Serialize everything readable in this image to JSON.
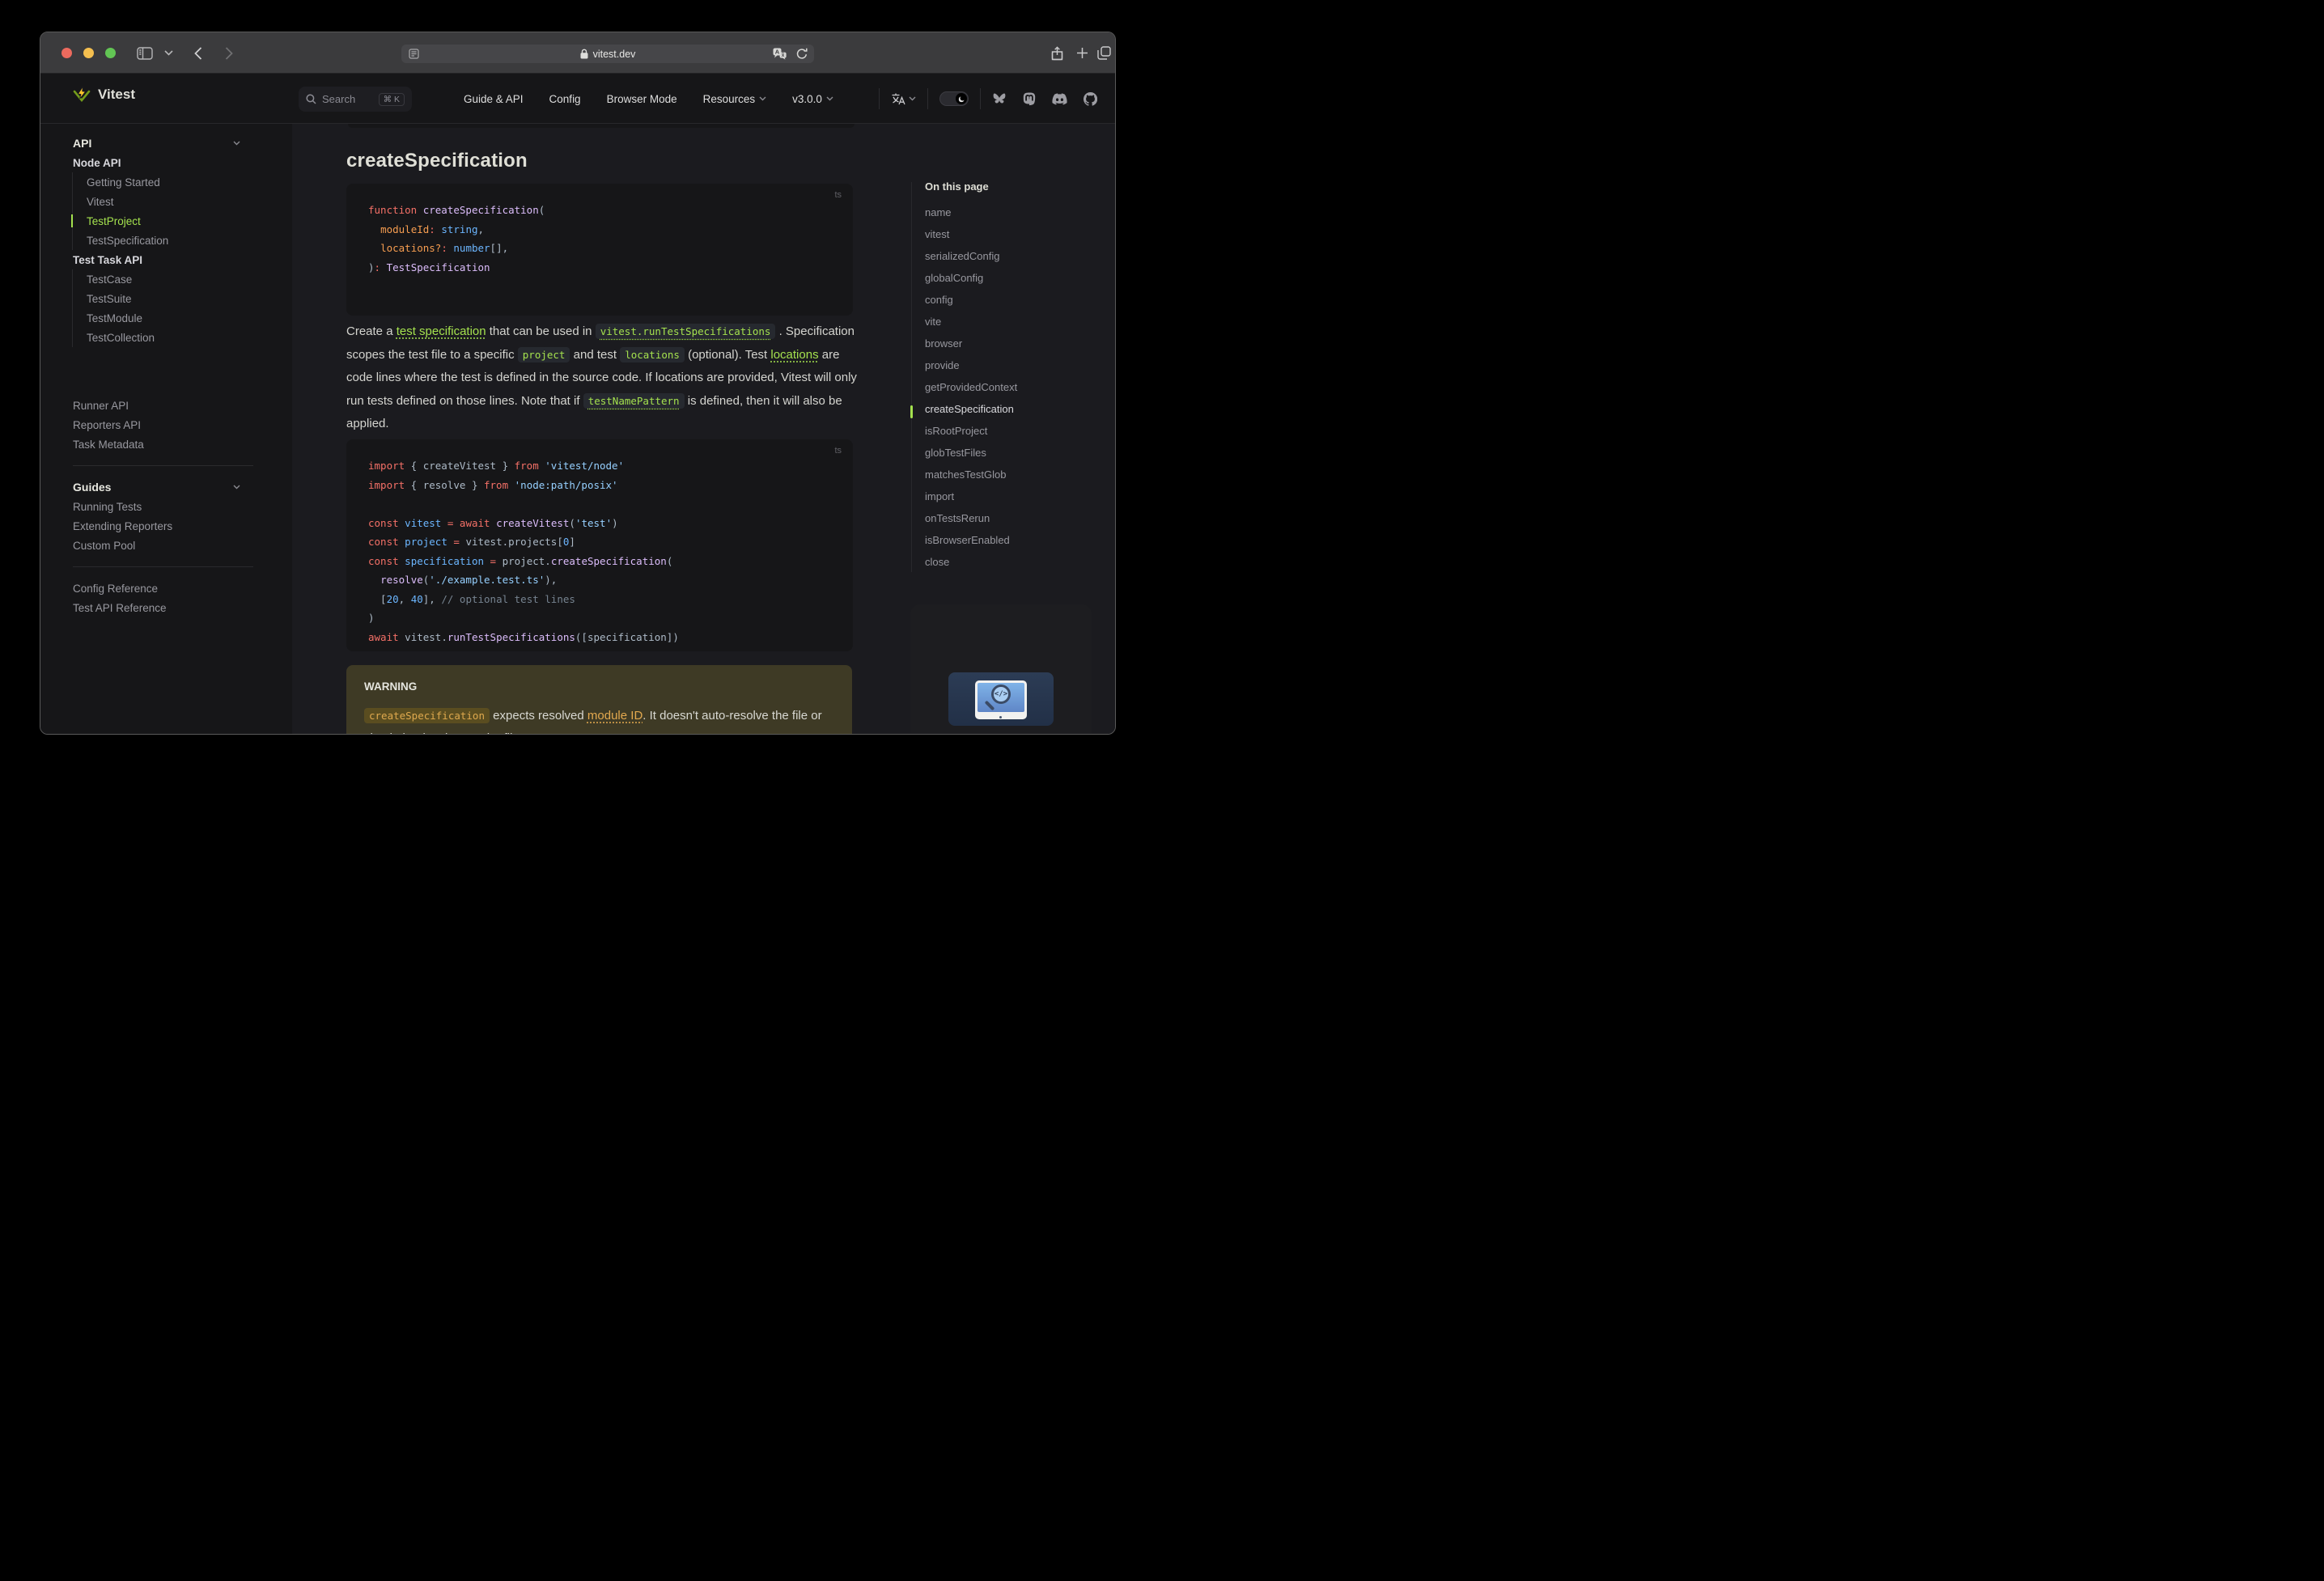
{
  "colors": {
    "accent_green": "#a4e14e",
    "content_bg": "#1b1b1f",
    "panel_bg": "#161618",
    "chrome_bg": "#3b3b3d",
    "warning_bg": "#3e3a25",
    "warning_orange": "#dfa94e"
  },
  "browser": {
    "url": "vitest.dev"
  },
  "nav": {
    "logo": "Vitest",
    "search_label": "Search",
    "search_shortcut": "⌘ K",
    "links": [
      {
        "label": "Guide & API",
        "chevron": false
      },
      {
        "label": "Config",
        "chevron": false
      },
      {
        "label": "Browser Mode",
        "chevron": false
      },
      {
        "label": "Resources",
        "chevron": true
      },
      {
        "label": "v3.0.0",
        "chevron": true
      }
    ]
  },
  "sidebar": {
    "items": [
      {
        "type": "title",
        "label": "API",
        "chevron": true
      },
      {
        "type": "section",
        "label": "Node API"
      },
      {
        "type": "subgroup",
        "items": [
          {
            "label": "Getting Started",
            "active": false
          },
          {
            "label": "Vitest",
            "active": false
          },
          {
            "label": "TestProject",
            "active": true
          },
          {
            "label": "TestSpecification",
            "active": false
          }
        ]
      },
      {
        "type": "section",
        "label": "Test Task API"
      },
      {
        "type": "subgroup",
        "items": [
          {
            "label": "TestCase",
            "active": false
          },
          {
            "label": "TestSuite",
            "active": false
          },
          {
            "label": "TestModule",
            "active": false
          },
          {
            "label": "TestCollection",
            "active": false
          }
        ]
      },
      {
        "type": "item",
        "label": "Runner API",
        "gap": true
      },
      {
        "type": "item",
        "label": "Reporters API"
      },
      {
        "type": "item",
        "label": "Task Metadata"
      },
      {
        "type": "divider"
      },
      {
        "type": "title",
        "label": "Guides",
        "chevron": true
      },
      {
        "type": "item",
        "label": "Running Tests"
      },
      {
        "type": "item",
        "label": "Extending Reporters"
      },
      {
        "type": "item",
        "label": "Custom Pool"
      },
      {
        "type": "divider"
      },
      {
        "type": "item",
        "label": "Config Reference"
      },
      {
        "type": "item",
        "label": "Test API Reference"
      }
    ]
  },
  "page": {
    "title": "createSpecification",
    "code1": {
      "lang": "ts",
      "lines": [
        [
          [
            "k",
            "function "
          ],
          [
            "f",
            "createSpecification"
          ],
          [
            "p",
            "("
          ]
        ],
        [
          [
            "p",
            "  "
          ],
          [
            "v",
            "moduleId"
          ],
          [
            "o",
            ":"
          ],
          [
            "p",
            " "
          ],
          [
            "t",
            "string"
          ],
          [
            "p",
            ","
          ]
        ],
        [
          [
            "p",
            "  "
          ],
          [
            "v",
            "locations?"
          ],
          [
            "o",
            ":"
          ],
          [
            "p",
            " "
          ],
          [
            "t",
            "number"
          ],
          [
            "p",
            "[],"
          ]
        ],
        [
          [
            "p",
            ")"
          ],
          [
            "o",
            ":"
          ],
          [
            "p",
            " "
          ],
          [
            "f",
            "TestSpecification"
          ]
        ]
      ]
    },
    "paragraph": [
      [
        "t",
        "Create a "
      ],
      [
        "l",
        "test specification"
      ],
      [
        "t",
        " that can be used in "
      ],
      [
        "cl",
        "vitest.runTestSpecifications"
      ],
      [
        "t",
        " . Specification scopes the test file to a specific "
      ],
      [
        "c",
        "project"
      ],
      [
        "t",
        " and test "
      ],
      [
        "c",
        "locations"
      ],
      [
        "t",
        " (optional). Test "
      ],
      [
        "l",
        "locations"
      ],
      [
        "t",
        " are code lines where the test is defined in the source code. If locations are provided, Vitest will only run tests defined on those lines. Note that if "
      ],
      [
        "cl",
        "testNamePattern"
      ],
      [
        "t",
        " is defined, then it will also be applied."
      ]
    ],
    "code2": {
      "lang": "ts",
      "lines": [
        [
          [
            "k",
            "import"
          ],
          [
            "p",
            " { createVitest } "
          ],
          [
            "k",
            "from"
          ],
          [
            "p",
            " "
          ],
          [
            "s",
            "'vitest/node'"
          ]
        ],
        [
          [
            "k",
            "import"
          ],
          [
            "p",
            " { resolve } "
          ],
          [
            "k",
            "from"
          ],
          [
            "p",
            " "
          ],
          [
            "s",
            "'node:path/posix'"
          ]
        ],
        [],
        [
          [
            "k",
            "const"
          ],
          [
            "p",
            " "
          ],
          [
            "t",
            "vitest"
          ],
          [
            "p",
            " "
          ],
          [
            "o",
            "="
          ],
          [
            "p",
            " "
          ],
          [
            "k",
            "await"
          ],
          [
            "p",
            " "
          ],
          [
            "f",
            "createVitest"
          ],
          [
            "p",
            "("
          ],
          [
            "s",
            "'test'"
          ],
          [
            "p",
            ")"
          ]
        ],
        [
          [
            "k",
            "const"
          ],
          [
            "p",
            " "
          ],
          [
            "t",
            "project"
          ],
          [
            "p",
            " "
          ],
          [
            "o",
            "="
          ],
          [
            "p",
            " "
          ],
          [
            "p",
            "vitest.projects["
          ],
          [
            "n",
            "0"
          ],
          [
            "p",
            "]"
          ]
        ],
        [
          [
            "k",
            "const"
          ],
          [
            "p",
            " "
          ],
          [
            "t",
            "specification"
          ],
          [
            "p",
            " "
          ],
          [
            "o",
            "="
          ],
          [
            "p",
            " "
          ],
          [
            "p",
            "project."
          ],
          [
            "f",
            "createSpecification"
          ],
          [
            "p",
            "("
          ]
        ],
        [
          [
            "p",
            "  "
          ],
          [
            "f",
            "resolve"
          ],
          [
            "p",
            "("
          ],
          [
            "s",
            "'./example.test.ts'"
          ],
          [
            "p",
            "),"
          ]
        ],
        [
          [
            "p",
            "  ["
          ],
          [
            "n",
            "20"
          ],
          [
            "p",
            ", "
          ],
          [
            "n",
            "40"
          ],
          [
            "p",
            "], "
          ],
          [
            "c",
            "// optional test lines"
          ]
        ],
        [
          [
            "p",
            ")"
          ]
        ],
        [
          [
            "k",
            "await"
          ],
          [
            "p",
            " vitest."
          ],
          [
            "f",
            "runTestSpecifications"
          ],
          [
            "p",
            "([specification])"
          ]
        ]
      ]
    },
    "warning": {
      "title": "WARNING",
      "segments": [
        [
          "c",
          "createSpecification"
        ],
        [
          "t",
          " expects resolved "
        ],
        [
          "l",
          "module ID"
        ],
        [
          "t",
          ". It doesn't auto-resolve the file or check that it exists on the file system."
        ]
      ]
    }
  },
  "aside": {
    "title": "On this page",
    "items": [
      {
        "label": "name",
        "active": false
      },
      {
        "label": "vitest",
        "active": false
      },
      {
        "label": "serializedConfig",
        "active": false
      },
      {
        "label": "globalConfig",
        "active": false
      },
      {
        "label": "config",
        "active": false
      },
      {
        "label": "vite",
        "active": false
      },
      {
        "label": "browser",
        "active": false
      },
      {
        "label": "provide",
        "active": false
      },
      {
        "label": "getProvidedContext",
        "active": false
      },
      {
        "label": "createSpecification",
        "active": true
      },
      {
        "label": "isRootProject",
        "active": false
      },
      {
        "label": "globTestFiles",
        "active": false
      },
      {
        "label": "matchesTestGlob",
        "active": false
      },
      {
        "label": "import",
        "active": false
      },
      {
        "label": "onTestsRerun",
        "active": false
      },
      {
        "label": "isBrowserEnabled",
        "active": false
      },
      {
        "label": "close",
        "active": false
      }
    ]
  },
  "icons": [
    "sidebar-toggle-icon",
    "chevron-down-icon",
    "back-icon",
    "forward-icon",
    "reader-icon",
    "lock-icon",
    "translate-icon",
    "reload-icon",
    "share-icon",
    "new-tab-icon",
    "tab-overview-icon",
    "search-icon",
    "language-icon",
    "moon-icon",
    "bluesky-icon",
    "mastodon-icon",
    "discord-icon",
    "github-icon",
    "vitest-logo-icon",
    "code-search-illustration"
  ]
}
